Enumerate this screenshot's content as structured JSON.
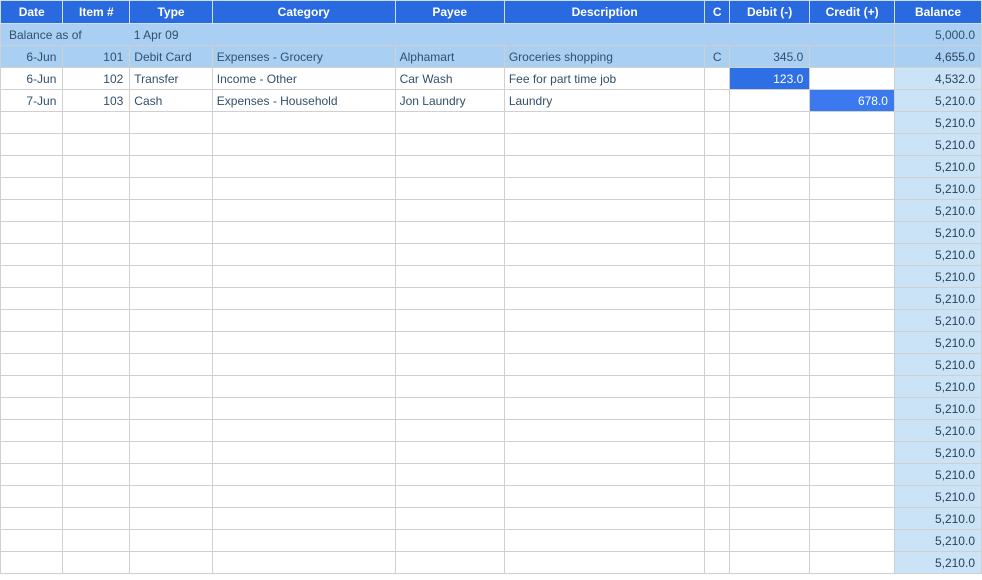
{
  "headers": {
    "date": "Date",
    "item": "Item #",
    "type": "Type",
    "category": "Category",
    "payee": "Payee",
    "description": "Description",
    "c": "C",
    "debit": "Debit  (-)",
    "credit": "Credit (+)",
    "balance": "Balance"
  },
  "opening": {
    "label_prefix": "Balance as of",
    "date_text": "1 Apr 09",
    "balance": "5,000.0"
  },
  "rows": [
    {
      "date": "6-Jun",
      "item": "101",
      "type": "Debit Card",
      "category": "Expenses - Grocery",
      "payee": "Alphamart",
      "description": "Groceries shopping",
      "c": "C",
      "debit": "345.0",
      "credit": "",
      "balance": "4,655.0",
      "highlight": true
    },
    {
      "date": "6-Jun",
      "item": "102",
      "type": "Transfer",
      "category": "Income - Other",
      "payee": "Car Wash",
      "description": "Fee for part time job",
      "c": "",
      "debit": "123.0",
      "credit": "",
      "balance": "4,532.0",
      "debit_style": "dark"
    },
    {
      "date": "7-Jun",
      "item": "103",
      "type": "Cash",
      "category": "Expenses - Household",
      "payee": "Jon Laundry",
      "description": "Laundry",
      "c": "",
      "debit": "",
      "credit": "678.0",
      "balance": "5,210.0",
      "credit_style": "mid"
    }
  ],
  "empty_row_balance": "5,210.0",
  "empty_row_count": 21
}
